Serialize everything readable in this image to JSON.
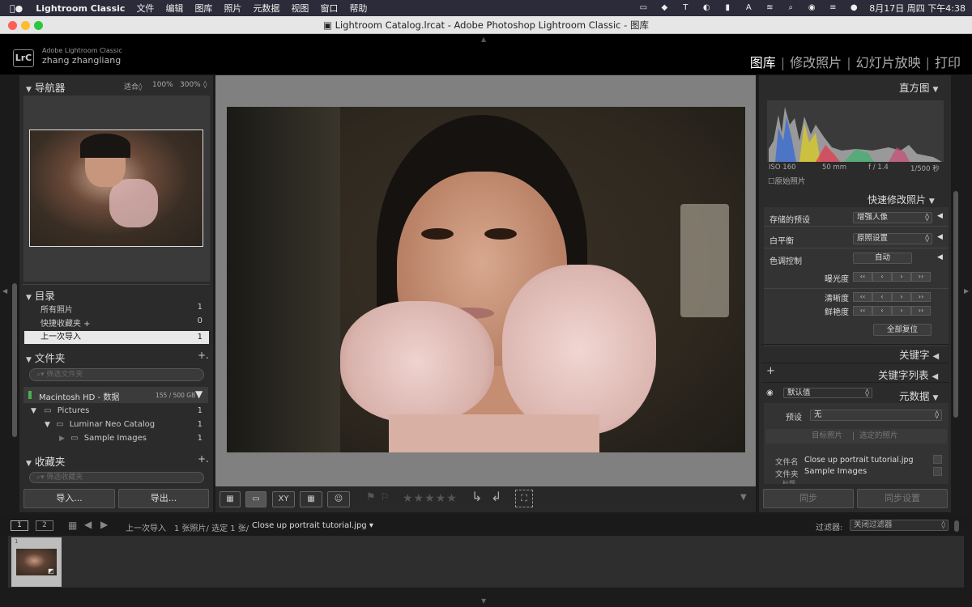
{
  "menubar": {
    "app": "Lightroom Classic",
    "items": [
      "文件",
      "编辑",
      "图库",
      "照片",
      "元数据",
      "视图",
      "窗口",
      "帮助"
    ],
    "datetime": "8月17日 周四 下午4:38",
    "status_icons": [
      "t-icon",
      "d-icon",
      "battery-icon",
      "a-icon",
      "wifi-icon",
      "search-icon",
      "user-icon",
      "control-center-icon",
      "siri-icon"
    ]
  },
  "window": {
    "title": "Lightroom Catalog.lrcat - Adobe Photoshop Lightroom Classic - 图库"
  },
  "identity": {
    "app_name": "Adobe Lightroom Classic",
    "user": "zhang zhangliang",
    "logo": "LrC"
  },
  "modules": [
    "图库",
    "修改照片",
    "幻灯片放映",
    "打印"
  ],
  "navigator": {
    "title": "导航器",
    "zoom_options": [
      "适合",
      "100%",
      "300%"
    ]
  },
  "catalog": {
    "title": "目录",
    "items": [
      {
        "label": "所有照片",
        "count": "1"
      },
      {
        "label": "快捷收藏夹 +",
        "count": "0"
      },
      {
        "label": "上一次导入",
        "count": "1"
      }
    ]
  },
  "folders": {
    "title": "文件夹",
    "add": "+.",
    "search_placeholder": "筛选文件夹",
    "volume": {
      "name": "Macintosh HD - 数据",
      "size": "155 / 500 GB"
    },
    "items": [
      {
        "label": "Pictures",
        "count": "1"
      },
      {
        "label": "Luminar Neo Catalog",
        "count": "1"
      },
      {
        "label": "Sample Images",
        "count": "1"
      }
    ]
  },
  "collections": {
    "title": "收藏夹",
    "add": "+.",
    "search_placeholder": "筛选收藏夹"
  },
  "left_buttons": {
    "import": "导入...",
    "export": "导出..."
  },
  "histogram": {
    "title": "直方图",
    "iso": "ISO 160",
    "focal": "50 mm",
    "aperture": "f / 1.4",
    "shutter": "1/500 秒",
    "original_label": "原始照片"
  },
  "quick_develop": {
    "title": "快速修改照片",
    "saved_preset_label": "存储的预设",
    "saved_preset_value": "增强人像",
    "white_balance_label": "白平衡",
    "white_balance_value": "原照设置",
    "tone_label": "色调控制",
    "auto_label": "自动",
    "exposure_label": "曝光度",
    "clarity_label": "清晰度",
    "vibrance_label": "鲜艳度",
    "reset_label": "全部复位"
  },
  "keywords": {
    "title": "关键字",
    "list_title": "关键字列表",
    "add": "+"
  },
  "metadata": {
    "title": "元数据",
    "default_label": "默认值",
    "preset_label": "预设",
    "preset_value": "无",
    "target_photo": "目标照片",
    "selected_photos": "选定的照片",
    "filename_label": "文件名",
    "filename_value": "Close up portrait tutorial.jpg",
    "folder_label": "文件夹",
    "folder_value": "Sample Images",
    "title_label": "标题"
  },
  "right_buttons": {
    "sync": "同步",
    "sync_settings": "同步设置"
  },
  "toolbar": {
    "stars": "★★★★★"
  },
  "filmstrip": {
    "views": [
      "1",
      "2"
    ],
    "source": "上一次导入",
    "count_info": "1 张照片/ 选定 1 张/",
    "current_file": "Close up portrait tutorial.jpg",
    "filter_label": "过滤器:",
    "filter_value": "关闭过滤器",
    "thumb_index": "1"
  },
  "colors": {
    "accent_select": "#e8e8e8",
    "panel": "#2b2b2b",
    "background": "#1b1b1b"
  }
}
